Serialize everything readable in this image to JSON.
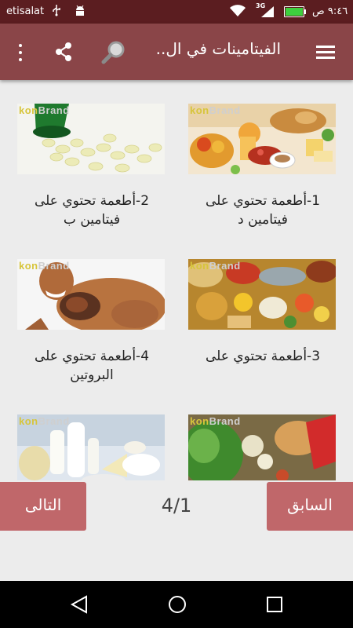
{
  "status_bar": {
    "carrier": "etisalat",
    "network_type": "3G",
    "time": "٩:٤٦ ص",
    "icons": [
      "usb-icon",
      "android-icon",
      "wifi-icon",
      "signal-icon",
      "battery-icon"
    ]
  },
  "toolbar": {
    "title": "الفيتامينات في ال..",
    "icons": [
      "menu-icon",
      "search-icon",
      "share-icon",
      "overflow-icon"
    ],
    "background": "#8a4548"
  },
  "watermark": {
    "part1": "kon",
    "part2": "Brand"
  },
  "cards": [
    {
      "label": "1-أطعمة تحتوي على فيتامين د",
      "image": "breakfast-food-image"
    },
    {
      "label": "2-أطعمة تحتوي على فيتامين ب",
      "image": "vitamin-tablets-image"
    },
    {
      "label": "3-أطعمة تحتوي على",
      "image": "assorted-food-image"
    },
    {
      "label": "4-أطعمة تحتوي على البروتين",
      "image": "man-eating-meat-image"
    },
    {
      "label": "",
      "image": "vegetables-image"
    },
    {
      "label": "",
      "image": "dairy-products-image"
    }
  ],
  "pagination": {
    "previous_label": "السابق",
    "next_label": "التالى",
    "page_indicator": "4/1",
    "button_color": "#c0676a"
  },
  "system_nav": {
    "icons": [
      "back-icon",
      "home-icon",
      "recents-icon"
    ]
  }
}
